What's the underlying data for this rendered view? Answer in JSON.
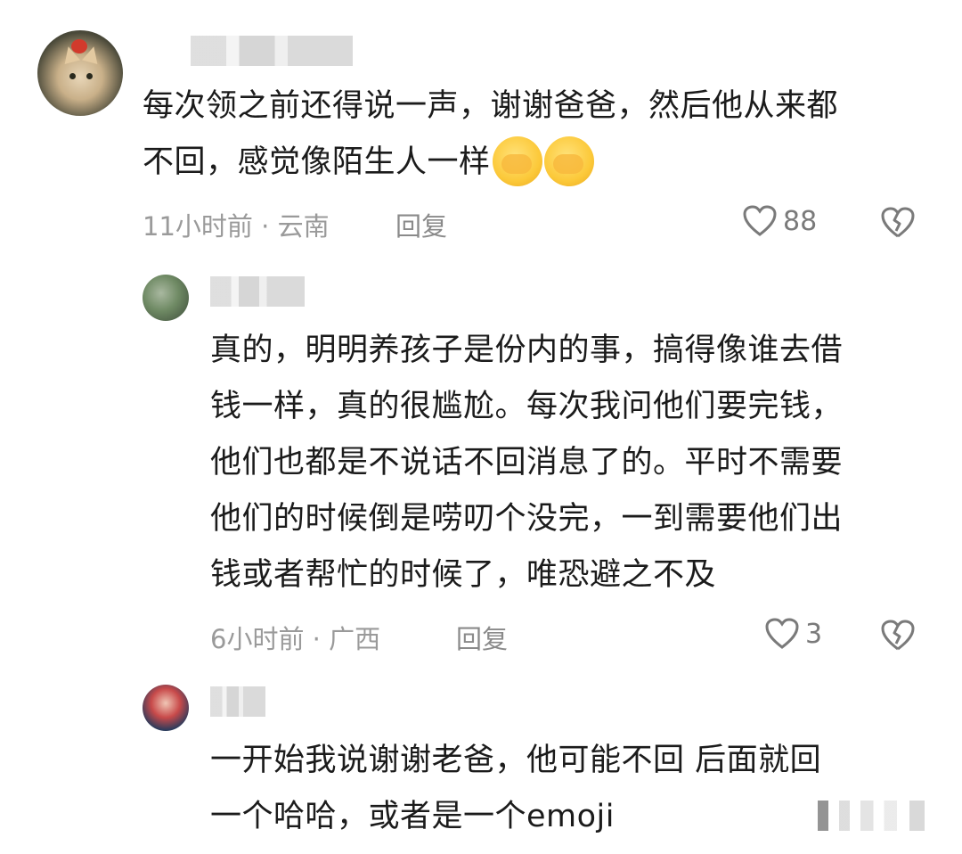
{
  "comments": [
    {
      "text_line1": "每次领之前还得说一声，谢谢爸爸，然后他从来都",
      "text_line2": "不回，感觉像陌生人一样",
      "time": "11小时前",
      "location": "云南",
      "reply_label": "回复",
      "likes": "88"
    },
    {
      "text_lines": [
        "真的，明明养孩子是份内的事，搞得像谁去借",
        "钱一样，真的很尴尬。每次我问他们要完钱，",
        "他们也都是不说话不回消息了的。平时不需要",
        "他们的时候倒是唠叨个没完，一到需要他们出",
        "钱或者帮忙的时候了，唯恐避之不及"
      ],
      "time": "6小时前",
      "location": "广西",
      "reply_label": "回复",
      "likes": "3"
    },
    {
      "text_line1": "一开始我说谢谢老爸，他可能不回 后面就回",
      "text_line2": "一个哈哈，或者是一个emoji"
    }
  ],
  "separator": "·",
  "icons": {
    "like": "heart-outline-icon",
    "dislike": "broken-heart-icon",
    "emoji": "facepalm-emoji"
  }
}
